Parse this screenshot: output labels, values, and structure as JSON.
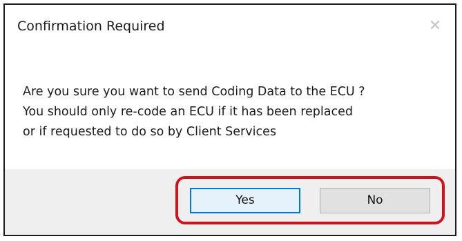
{
  "dialog": {
    "title": "Confirmation Required",
    "close_glyph": "✕",
    "message_lines": [
      "Are you sure you want to send Coding Data to the ECU ?",
      "You should only re-code an ECU if it has been replaced",
      "or if requested to do so by Client Services"
    ],
    "buttons": {
      "yes_label": "Yes",
      "no_label": "No"
    }
  },
  "colors": {
    "highlight_border": "#d0121b",
    "focus_border": "#0078d7",
    "footer_background": "#efefef"
  }
}
